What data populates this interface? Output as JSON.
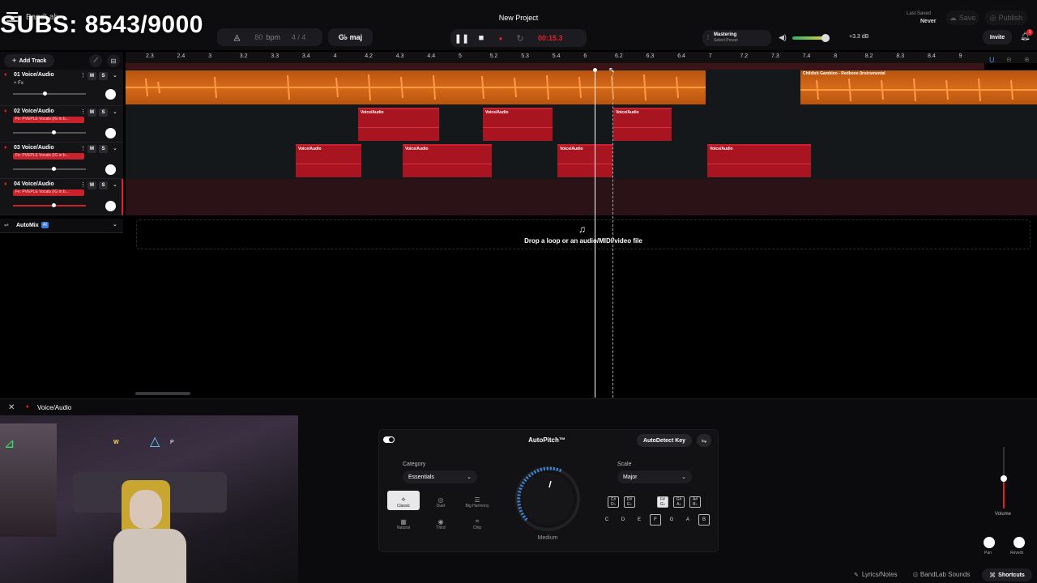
{
  "overlay": {
    "subs": "SUBS: 8543/9000"
  },
  "header": {
    "app_name": "BandLab",
    "project_title": "New Project",
    "last_saved_label": "Last Saved",
    "last_saved_value": "Never",
    "save_label": "Save",
    "publish_label": "Publish",
    "invite_label": "Invite",
    "bpm_value": "80",
    "bpm_unit": "bpm",
    "time_signature": "4 / 4",
    "key": "G♭ maj",
    "time_display": "00:15.3",
    "mastering_label": "Mastering",
    "mastering_preset": "Select Preset",
    "volume_db": "+3.3 dB",
    "notification_count": "1"
  },
  "toolbar": {
    "add_track_label": "Add Track"
  },
  "ruler": {
    "ticks": [
      "2.3",
      "2.4",
      "3",
      "3.2",
      "3.3",
      "3.4",
      "4",
      "4.2",
      "4.3",
      "4.4",
      "5",
      "5.2",
      "5.3",
      "5.4",
      "6",
      "6.2",
      "6.3",
      "6.4",
      "7",
      "7.2",
      "7.3",
      "7.4",
      "8",
      "8.2",
      "8.3",
      "8.4",
      "9"
    ]
  },
  "tracks": [
    {
      "name": "01  Voice/Audio",
      "fx": "+ Fx",
      "fx_plugin": false
    },
    {
      "name": "02  Voice/Audio",
      "fx": "Fx: PVEPLE Vocals (IG in b...",
      "fx_plugin": true
    },
    {
      "name": "03  Voice/Audio",
      "fx": "Fx: PVEPLE Vocals (IG in b...",
      "fx_plugin": true
    },
    {
      "name": "04  Voice/Audio",
      "fx": "Fx: PVEPLE Vocals (IG in b...",
      "fx_plugin": true
    }
  ],
  "regions": {
    "track1_right": "Childish Gambino - Redbone (Instrumental",
    "clip_label": "Voice/Audio"
  },
  "automix": {
    "label": "AutoMix",
    "badge": "AI"
  },
  "drop_zone": {
    "text": "Drop a loop or an audio/MIDI/video file"
  },
  "bottom_panel": {
    "track_label": "Voice/Audio",
    "effect_title": "AutoPitch™",
    "autodetect_label": "AutoDetect Key",
    "category_label": "Category",
    "category_value": "Essentials",
    "scale_label": "Scale",
    "scale_value": "Major",
    "knob_label": "Medium",
    "options": [
      "Classic",
      "Duet",
      "Big Harmony",
      "Natural",
      "Third",
      "Chip"
    ],
    "sharp_keys": [
      "C#\nD♭",
      "D#\nE♭",
      "F#\nG♭",
      "G#\nA♭",
      "A#\nB♭"
    ],
    "natural_keys": [
      "C",
      "D",
      "E",
      "F",
      "G",
      "A",
      "B"
    ],
    "volume_label": "Volume",
    "pan_label": "Pan",
    "reverb_label": "Reverb"
  },
  "footer": {
    "lyrics_label": "Lyrics/Notes",
    "sounds_label": "BandLab Sounds",
    "shortcuts_label": "Shortcuts"
  },
  "colors": {
    "accent_orange": "#e4701c",
    "region_red": "#a8141f",
    "record_red": "#e0202a"
  }
}
